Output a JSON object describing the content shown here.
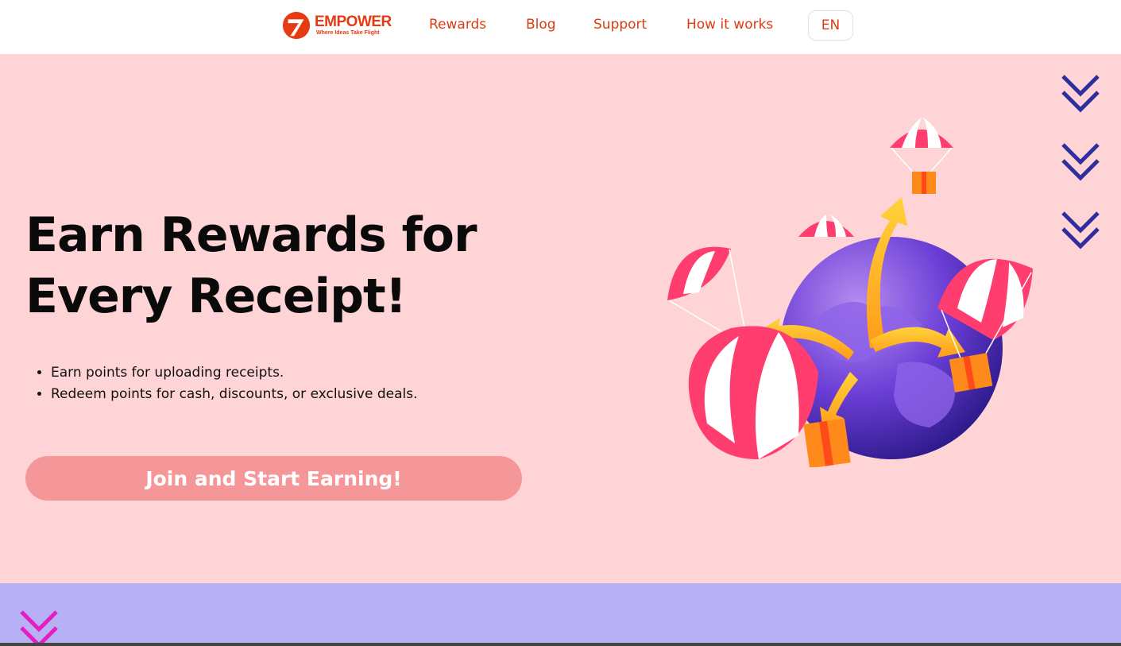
{
  "brand": {
    "name": "EMPOWER",
    "tagline": "Where Ideas Take Flight",
    "color": "#e63a12"
  },
  "nav": {
    "links": [
      "Rewards",
      "Blog",
      "Support",
      "How it works"
    ],
    "language": "EN"
  },
  "hero": {
    "headline_line1": "Earn Rewards for",
    "headline_line2": "Every Receipt!",
    "bullets": [
      "Earn points for uploading receipts.",
      "Redeem points for cash, discounts, or exclusive deals."
    ],
    "cta_label": "Join and Start Earning!",
    "background": "#ffd4d6",
    "cta_color": "#f59798",
    "illustration": "globe-parachute-gifts-illustration",
    "scroll_icon": "double-chevron-down-icon"
  },
  "next_section": {
    "background": "#b8b0f4",
    "scroll_icon": "double-chevron-down-icon"
  }
}
